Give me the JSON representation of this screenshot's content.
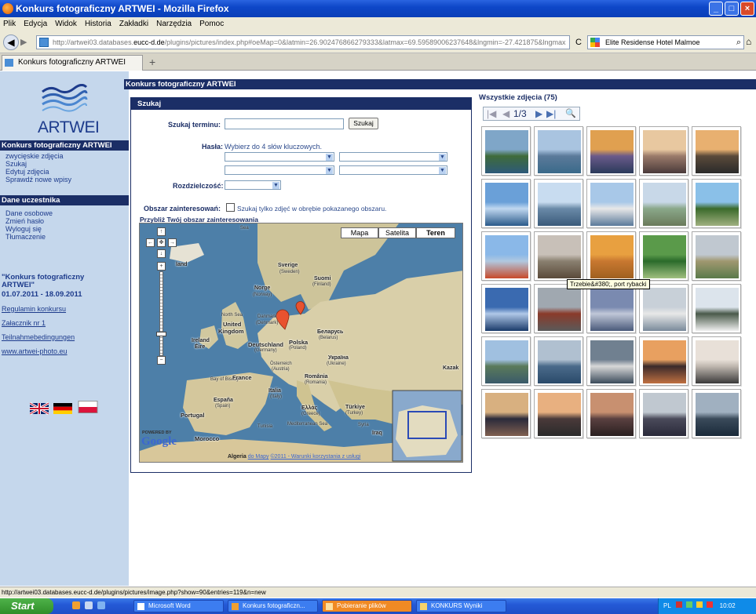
{
  "window": {
    "title": "Konkurs fotograficzny ARTWEI - Mozilla Firefox",
    "controls": [
      "_",
      "□",
      "×"
    ]
  },
  "menu": [
    "Plik",
    "Edycja",
    "Widok",
    "Historia",
    "Zakładki",
    "Narzędzia",
    "Pomoc"
  ],
  "nav": {
    "back": "◀",
    "forward": "▶",
    "url_prefix": "http://artwei03.databases.",
    "url_host": "eucc-d.de",
    "url_path": "/plugins/pictures/index.php#oeMap=0&latmin=26.902476866279333&latmax=69.59589006237648&lngmin=-27.421875&lngmax",
    "reload": "C",
    "search_value": "Elite Residense Hotel Malmoe",
    "search_icon": "magnifier-icon",
    "home": "⌂"
  },
  "tab": {
    "label": "Konkurs fotograficzny ARTWEI",
    "new_tab": "+"
  },
  "sidebar": {
    "logo_text": "ARTWEI",
    "section1": "Konkurs fotograficzny ARTWEI",
    "section1_links": [
      "zwycięskie zdjęcia",
      "Szukaj",
      "Edytuj zdjęcia",
      "Sprawdź nowe wpisy"
    ],
    "section2": "Dane uczestnika",
    "section2_links": [
      "Dane osobowe",
      "Zmień hasło",
      "Wyloguj się",
      "Tłumaczenie"
    ],
    "contest_title": "\"Konkurs fotograficzny ARTWEI\"",
    "contest_dates": "01.07.2011 - 18.09.2011",
    "footer_links": [
      "Regulamin konkursu",
      "Załacznik nr 1",
      "Teilnahmebedingungen",
      "www.artwei-photo.eu"
    ],
    "flags": [
      "flag-uk",
      "flag-de",
      "flag-pl"
    ]
  },
  "page_title": "Konkurs fotograficzny ARTWEI",
  "search": {
    "header": "Szukaj",
    "term_label": "Szukaj terminu:",
    "term_value": "",
    "search_button": "Szukaj",
    "keywords_label": "Hasła:",
    "keywords_hint": "Wybierz do 4 słów kluczowych.",
    "resolution_label": "Rozdzielczość:",
    "area_label": "Obszar zainteresowań:",
    "area_checkbox_label": "Szukaj tylko zdjęć w obrębie pokazanego obszaru.",
    "zoom_hint": "Przybliż Twój obszar zainteresowania"
  },
  "map": {
    "types": [
      "Mapa",
      "Satelita",
      "Teren"
    ],
    "active_type": "Teren",
    "labels": {
      "sea": "Sea",
      "sverige": "Sverige",
      "sverige_sub": "(Sweden)",
      "suomi": "Suomi",
      "suomi_sub": "(Finland)",
      "norge": "Norge",
      "norge_sub": "(Norway)",
      "north_sea": "North Sea",
      "danmark": "Danmark",
      "danmark_sub": "(Denmark)",
      "united_kingdom": "United Kingdom",
      "ireland": "Ireland",
      "eire": "Éire",
      "deutschland": "Deutschland",
      "deutschland_sub": "(Germany)",
      "polska": "Polska",
      "polska_sub": "(Poland)",
      "belarus": "Беларусь",
      "belarus_sub": "(Belarus)",
      "osterreich": "Österreich",
      "osterreich_sub": "(Austria)",
      "ukraina": "Україна",
      "ukraina_sub": "(Ukraine)",
      "bay_of_biscay": "Bay of Biscay",
      "france": "France",
      "romania": "România",
      "romania_sub": "(Romania)",
      "italia": "Italia",
      "italia_sub": "(Italy)",
      "espana": "España",
      "espana_sub": "(Spain)",
      "portugal": "Portugal",
      "ellas": "Ελλάς",
      "ellas_sub": "(Greece)",
      "turkiye": "Türkiye",
      "turkiye_sub": "(Turkey)",
      "tunisia": "Tunisia",
      "mediterranean": "Mediterranean Sea",
      "syria": "Syria",
      "iraq": "Iraq",
      "morocco": "Morocco",
      "algeria": "Algeria",
      "kazak": "Kazak",
      "land": "land"
    },
    "google_logo": "Google",
    "powered_by": "POWERED BY",
    "attribution": "©2011 - Warunki korzystania z usługi",
    "attribution_prefix": "do Mapy",
    "zoom_in": "+",
    "zoom_out": "−",
    "pan_up": "↑",
    "pan_down": "↓",
    "pan_left": "←",
    "pan_right": "→",
    "pan_center": "✥",
    "markers": [
      "marker-baltic",
      "marker-denmark"
    ]
  },
  "gallery": {
    "title": "Wszystkie zdjęcia (75)",
    "pager_text": "1/3",
    "first": "|◀",
    "prev": "◀",
    "next": "▶",
    "last": "▶|",
    "zoom": "🔍",
    "tooltip": "Trzebie&#380;, port rybacki"
  },
  "status": "http://artwei03.databases.eucc-d.de/plugins/pictures/image.php?show=90&entries=119&n=new",
  "taskbar": {
    "start": "Start",
    "items": [
      {
        "label": "Microsoft Word",
        "active": false
      },
      {
        "label": "Konkurs fotograficzn...",
        "active": false
      },
      {
        "label": "Pobieranie plików",
        "active": true
      },
      {
        "label": "KONKURS Wyniki",
        "active": false
      }
    ],
    "tray_lang": "PL",
    "clock": "10:02"
  },
  "colors": {
    "navy": "#1b2e66",
    "sidebar_bg": "#c5d7ec",
    "xp_blue": "#2459d6",
    "sea": "#4d7fa8",
    "land": "#d9cfa9"
  }
}
